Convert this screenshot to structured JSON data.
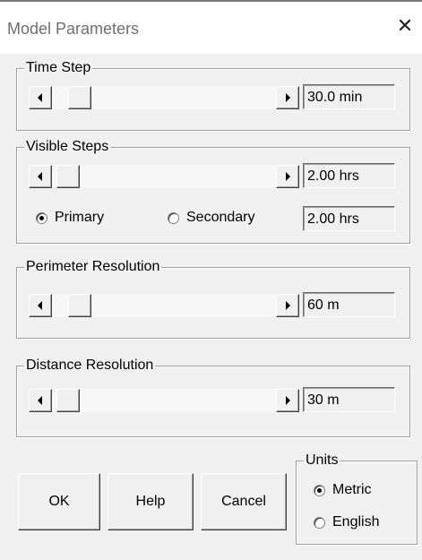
{
  "window": {
    "title": "Model Parameters",
    "close_glyph": "✕"
  },
  "groups": [
    {
      "label": "Time Step",
      "value": "30.0 min",
      "slider_level": 0.08
    },
    {
      "label": "Visible Steps",
      "value": "2.00 hrs",
      "slider_level": 0.02
    },
    {
      "label": "Perimeter Resolution",
      "value": "60 m",
      "slider_level": 0.08
    },
    {
      "label": "Distance Resolution",
      "value": "30 m",
      "slider_level": 0.02
    }
  ],
  "visible_steps": {
    "primary_label": "Primary",
    "secondary_label": "Secondary",
    "secondary_value": "2.00 hrs",
    "selected": "primary"
  },
  "buttons": {
    "ok": "OK",
    "help": "Help",
    "cancel": "Cancel"
  },
  "units": {
    "label": "Units",
    "metric": "Metric",
    "english": "English",
    "selected": "metric"
  }
}
